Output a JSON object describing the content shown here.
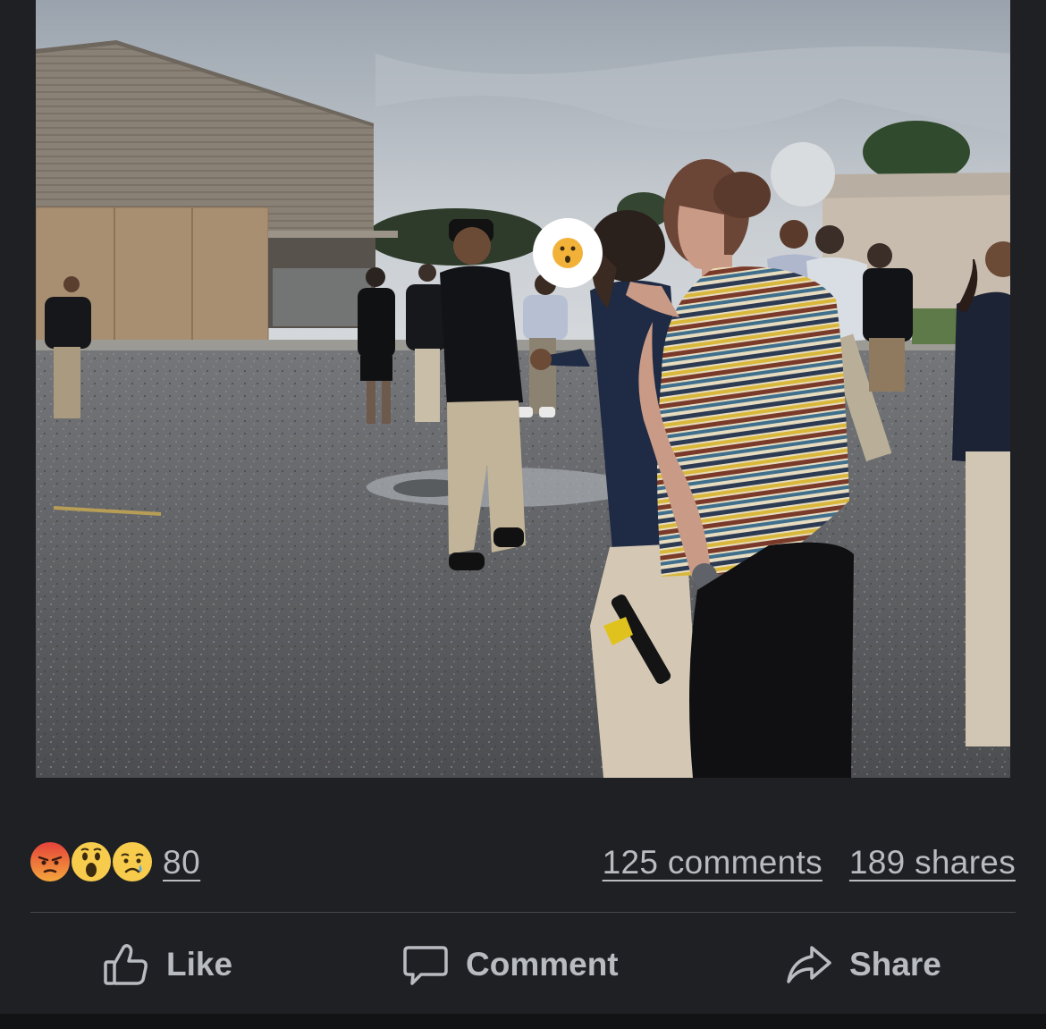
{
  "post": {
    "photo": {
      "alt_icon": "photo-of-schoolyard",
      "face_cover_emoji": "surprised-face-icon"
    },
    "reactions": {
      "icons": [
        "angry-reaction-icon",
        "wow-reaction-icon",
        "sad-reaction-icon"
      ],
      "count": "80"
    },
    "comments_label": "125 comments",
    "shares_label": "189 shares",
    "actions": {
      "like": "Like",
      "comment": "Comment",
      "share": "Share"
    },
    "colors": {
      "background": "#1f2024",
      "text": "#b8bbc0",
      "divider": "#45474c"
    }
  }
}
